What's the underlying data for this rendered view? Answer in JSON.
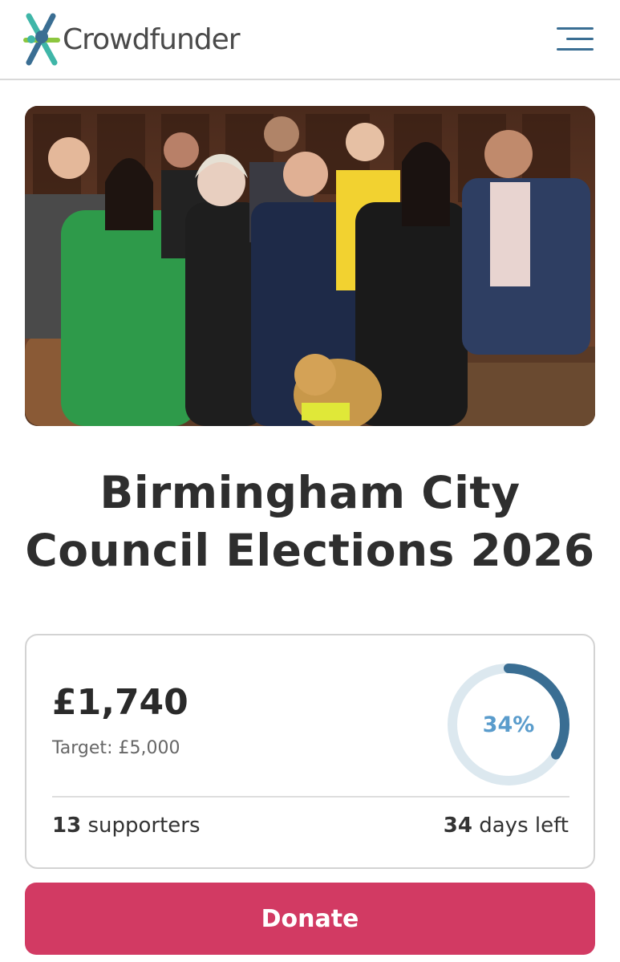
{
  "brand": {
    "name": "Crowdfunder",
    "logo_icon": "crowdfunder-figure-icon",
    "colors": {
      "teal": "#3fb6a8",
      "blue": "#3a6e93",
      "green": "#8cc63f"
    }
  },
  "header": {
    "menu_icon": "hamburger-menu-icon"
  },
  "hero": {
    "image": "group-photo-council-chamber"
  },
  "project": {
    "title": "Birmingham City Council Elections 2026"
  },
  "stats": {
    "raised": "£1,740",
    "target": "Target: £5,000",
    "percent_label": "34%",
    "percent_value": 0.34,
    "supporters_count": "13",
    "supporters_label": "supporters",
    "days_count": "34",
    "days_label": "days left",
    "ring_color": "#3a6e93",
    "ring_track_color": "#dce8ef"
  },
  "cta": {
    "donate_label": "Donate",
    "color": "#d23a63"
  }
}
